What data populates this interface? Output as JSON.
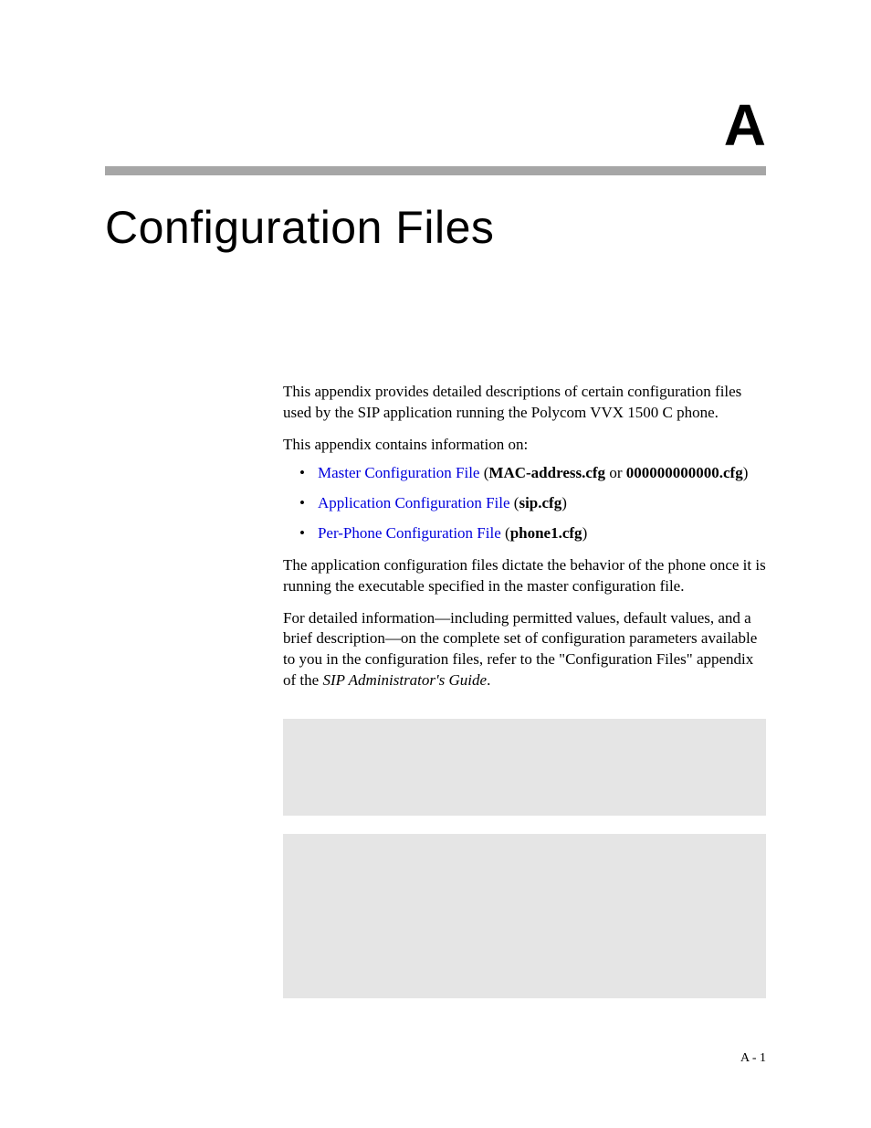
{
  "appendix": {
    "letter": "A",
    "title": "Configuration Files"
  },
  "content": {
    "para1": "This appendix provides detailed descriptions of certain configuration files used by the SIP application running the Polycom VVX 1500 C phone.",
    "para2": "This appendix contains information on:",
    "bullets": [
      {
        "link": "Master Configuration File",
        "suffix1": " (",
        "bold1": "MAC-address.cfg",
        "mid": " or ",
        "bold2": "000000000000.cfg",
        "suffix2": ")"
      },
      {
        "link": "Application Configuration File",
        "suffix1": " (",
        "bold1": "sip.cfg",
        "mid": "",
        "bold2": "",
        "suffix2": ")"
      },
      {
        "link": "Per-Phone Configuration File",
        "suffix1": " (",
        "bold1": "phone1.cfg",
        "mid": "",
        "bold2": "",
        "suffix2": ")"
      }
    ],
    "para3": "The application configuration files dictate the behavior of the phone once it is running the executable specified in the master configuration file.",
    "para4_pre": "For detailed information—including permitted values, default values, and a brief description—on the complete set of configuration parameters available to you in the configuration files, refer to the \"Configuration Files\" appendix of the ",
    "para4_italic": "SIP Administrator's Guide",
    "para4_post": "."
  },
  "footer": {
    "page_number": "A - 1"
  }
}
